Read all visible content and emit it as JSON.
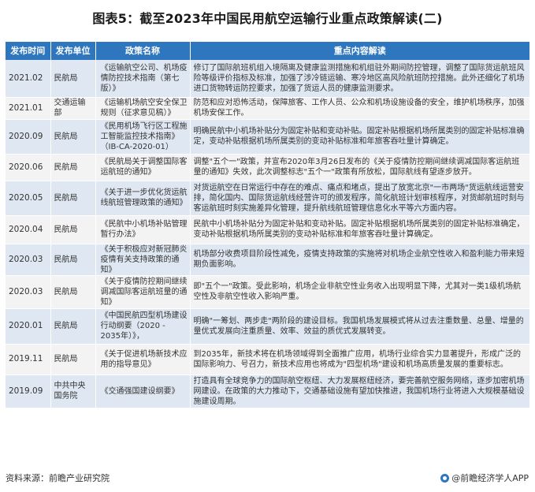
{
  "title": "图表5：截至2023年中国民用航空运输行业重点政策解读(二)",
  "table": {
    "headers": [
      "发布时间",
      "发布单位",
      "政策名称",
      "重点内容解读"
    ],
    "rows": [
      {
        "date": "2021.02",
        "unit": "民航局",
        "policy": "《运输航空公司、机场疫情防控技术指南（第七版）》",
        "content": "修订了国际航班机组入境隔离及健康监测措施和机组驻外期间防控管理，调整了国际货运航班风险等级评价指标及标准，加强了涉冷链运输、寒冷地区高风险航班防控措施。此外还细化了机场进口货物转运防控要求，加强了货运人员的健康监测要求。"
      },
      {
        "date": "2021.01",
        "unit": "交通运输部",
        "policy": "《运输机场航空安全保卫规则（征求意见稿）》",
        "content": "防范和应对恐怖活动，保障旅客、工作人员、公众和机场设施设备的安全，维护机场秩序，加强机场安保工作。"
      },
      {
        "date": "2020.09",
        "unit": "民航局",
        "policy": "《民用机场飞行区工程施工智能监控技术指南》（IB-CA-2020-01）",
        "content": "明确民航中小机场补贴分为固定补贴和变动补贴。固定补贴根据机场所属类别的固定补贴标准确定，变动补贴根据机场所属类别的变动补贴标准和年旅客吞吐量计算确定。"
      },
      {
        "date": "2020.06",
        "unit": "民航局",
        "policy": "《民航局关于调整国际客运航班的通知》",
        "content": "调整\"五个一\"政策，并宣布2020年3月26日发布的《关于疫情防控期间继续调减国际客运航班量的通知》失效，此次调整标志\"五个一\"政策有所放松，国际航线有望逐步放开。"
      },
      {
        "date": "2020.05",
        "unit": "民航局",
        "policy": "《关于进一步优化货运航线航班管理政策的通知》",
        "content": "对货运航空在日常运行中存在的难点、痛点和堵点，提出了放宽北京\"一市两场\"货运航线运营安排，简化国内、国际货运航线经营许可的颁发程序，简化航班计划审核程序，对货邮航班时刻与客运航班时刻实施差异化管理，提升航线航班管理信息化水平等六方面内容。"
      },
      {
        "date": "2020.04",
        "unit": "民航局",
        "policy": "《民航中小机场补贴管理暂行办法》",
        "content": "民航中小机场补贴分为固定补贴和变动补贴。固定补贴根据机场所属类别的固定补贴标准确定，变动补贴根据机场所属类别的变动补贴标准和年旅客吞吐量计算确定。"
      },
      {
        "date": "2020.03",
        "unit": "民航局",
        "policy": "《关于积极应对新冠肺炎疫情有关支持政策的通知》",
        "content": "机场部分收费项目阶段性减免，疫情支持政策的实施将对机场企业航空性收入和盈利能力带来短期负面影响。"
      },
      {
        "date": "2020.03",
        "unit": "民航局",
        "policy": "《关于疫情防控期间继续调减国际客运航班量的通知》",
        "content": "即\"五个一\"政策。受此影响，机场企业非航空性业务收入出现明显下降，尤其对一类1级机场航空性及非航空性收入影响严重。"
      },
      {
        "date": "2020.01",
        "unit": "民航局",
        "policy": "《中国民航四型机场建设行动纲要（2020 - 2035年）》，",
        "content": "明确\"一筹划、两步走\"两阶段的建设目标。我国机场发展模式将从过去注重数量、总量、增量的量优式发展向注重质量、效率、效益的质优式发展转变。"
      },
      {
        "date": "2019.11",
        "unit": "民航局",
        "policy": "《关于促进机场新技术应用的指导意见》",
        "content": "到2035年，新技术将在机场领域得到全面推广应用，机场行业综合实力显著提升，形成广泛的国际影响力、号召力，新技术应用也将成为\"四型机场\"建设和机场高质量发展的重要标志。"
      },
      {
        "date": "2019.09",
        "unit": "中共中央国务院",
        "policy": "《交通强国建设纲要》",
        "content": "打造具有全球竞争力的国际航空枢纽、大力发展枢纽经济，要完善航空服务网络，逐步加密机场网建设。在政策的大力推动下，交通基础设施有望加快推进，我国机场行业将进入大规模基础设施建设周期。"
      }
    ]
  },
  "source": "资料来源：前瞻产业研究院",
  "brand": "@前瞻经济学人APP",
  "colors": {
    "header_bg": "#2e77bf",
    "row_odd": "#dfe8f2",
    "row_even": "#f3f3f3"
  }
}
